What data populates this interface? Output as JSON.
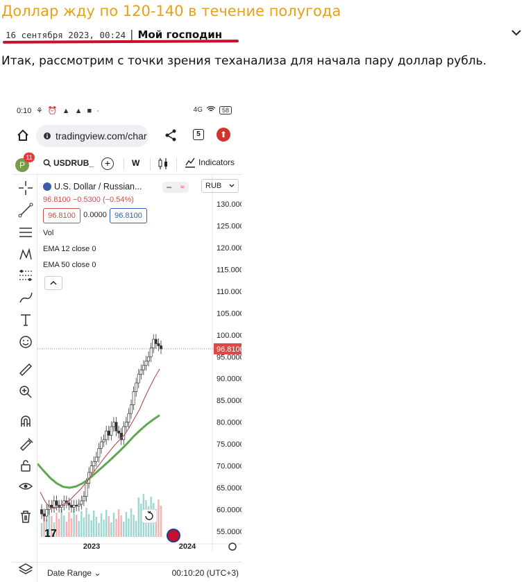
{
  "post": {
    "title": "Доллар жду по 120-140 в течение полугода",
    "date": "16 сентября 2023, 00:24",
    "separator": "|",
    "author": "Мой господин",
    "body": "Итак, рассмотрим с точки зрения теханализа для начала пару доллар рубль.",
    "accent_color": "#e6a11a",
    "underline_color": "#c8102e"
  },
  "phone": {
    "status": {
      "time": "0:10",
      "battery": "58",
      "signal": "4G"
    },
    "browser": {
      "url": "tradingview.com/char",
      "tabs_count": "5"
    },
    "toolbar": {
      "notifications": "11",
      "avatar_letter": "P",
      "symbol": "USDRUB_",
      "interval": "W",
      "indicators_label": "Indicators"
    },
    "legend": {
      "title": "U.S. Dollar / Russian...",
      "price_change": "96.8100  −0.5300 (−0.54%)",
      "sell": "96.8100",
      "spread": "0.0000",
      "buy": "96.8100",
      "indicators": [
        "Vol",
        "EMA 12 close 0",
        "EMA 50 close 0"
      ]
    },
    "currency": "RUB",
    "last_price_label": "96.8100",
    "bottom": {
      "date_range": "Date Range",
      "clock": "00:10:20 (UTC+3)"
    },
    "colors": {
      "up": "#26a69a",
      "down": "#ef5350",
      "ema12": "#b05a5a",
      "ema50": "#5ea84f",
      "badge": "#e04646"
    }
  },
  "chart_data": {
    "type": "line",
    "title": "",
    "xlabel": "",
    "ylabel": "",
    "ylim": [
      52,
      132
    ],
    "y_ticks": [
      "130.0000",
      "125.0000",
      "120.0000",
      "115.0000",
      "110.0000",
      "105.0000",
      "100.0000",
      "95.0000",
      "90.0000",
      "85.0000",
      "80.0000",
      "75.0000",
      "70.0000",
      "65.0000",
      "60.0000",
      "55.0000"
    ],
    "x_ticks": [
      "2023",
      "2024"
    ],
    "series": [
      {
        "values": [
          59,
          58.5,
          60,
          61,
          60.5,
          62,
          61,
          60.5,
          61,
          62,
          61.5,
          61,
          60.5,
          61,
          60.8,
          61.2,
          62,
          63,
          66,
          68.5,
          70,
          71,
          72,
          74,
          75.5,
          76,
          78,
          77,
          79,
          80,
          78,
          77.5,
          76,
          79,
          80,
          82,
          84,
          87,
          89,
          91,
          92,
          93,
          94,
          95,
          97,
          99,
          98,
          97.5,
          96.8
        ]
      },
      {
        "name": "EMA 12 close 0",
        "values": [
          64,
          61.8,
          60.4,
          60.3,
          60.8,
          61.4,
          62.2,
          63.4,
          64.5,
          65.9,
          67.4,
          69,
          70.5,
          72,
          73.4,
          74.8,
          76,
          77.2,
          79,
          81,
          83,
          85.6,
          88,
          90.2,
          92.2
        ]
      },
      {
        "name": "EMA 50 close 0",
        "values": [
          70.5,
          68.8,
          67.2,
          66,
          65.2,
          65,
          65.3,
          66,
          67,
          68.3,
          69.6,
          70.9,
          72.3,
          73.7,
          75.2,
          76.8,
          78.2,
          79.5,
          80.6,
          81.6
        ]
      }
    ]
  }
}
